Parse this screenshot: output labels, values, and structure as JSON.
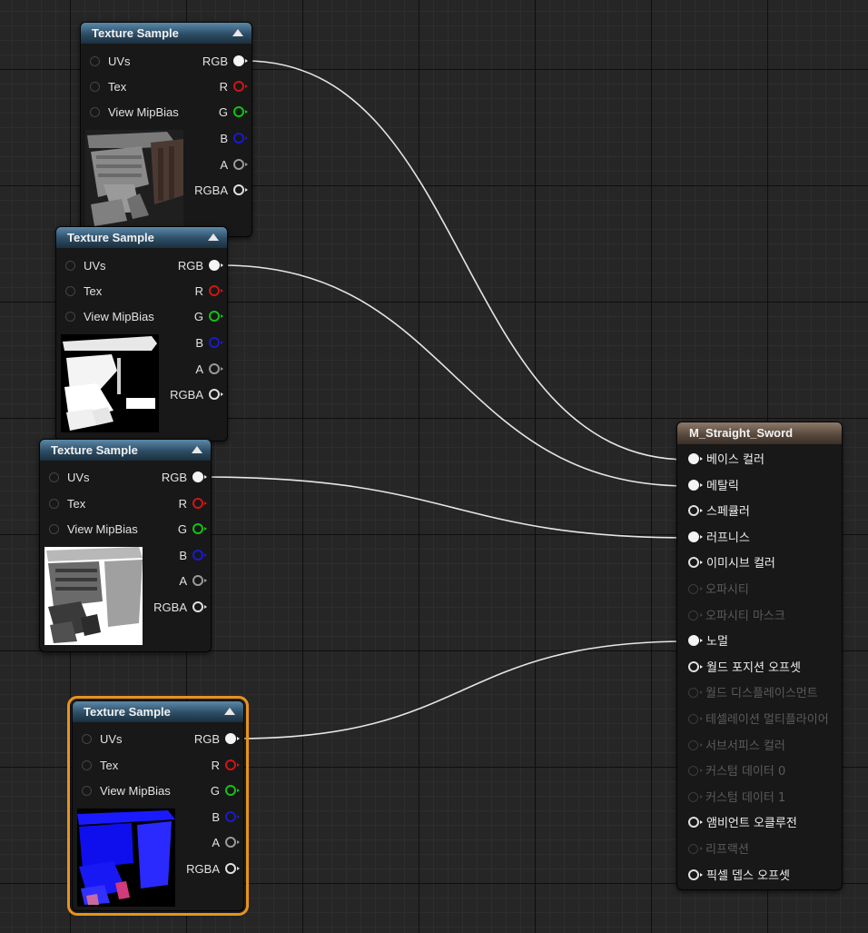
{
  "texture_nodes": [
    {
      "title": "Texture Sample",
      "inputs": [
        "UVs",
        "Tex",
        "View MipBias"
      ],
      "outputs": [
        "RGB",
        "R",
        "G",
        "B",
        "A",
        "RGBA"
      ],
      "preview": "grayscale-basecolor-texture",
      "selected": false
    },
    {
      "title": "Texture Sample",
      "inputs": [
        "UVs",
        "Tex",
        "View MipBias"
      ],
      "outputs": [
        "RGB",
        "R",
        "G",
        "B",
        "A",
        "RGBA"
      ],
      "preview": "white-metallic-mask-texture",
      "selected": false
    },
    {
      "title": "Texture Sample",
      "inputs": [
        "UVs",
        "Tex",
        "View MipBias"
      ],
      "outputs": [
        "RGB",
        "R",
        "G",
        "B",
        "A",
        "RGBA"
      ],
      "preview": "grey-roughness-texture",
      "selected": false
    },
    {
      "title": "Texture Sample",
      "inputs": [
        "UVs",
        "Tex",
        "View MipBias"
      ],
      "outputs": [
        "RGB",
        "R",
        "G",
        "B",
        "A",
        "RGBA"
      ],
      "preview": "blue-normal-map-texture",
      "selected": true
    }
  ],
  "material_node": {
    "title": "M_Straight_Sword",
    "pins": [
      {
        "label": "베이스 컬러",
        "active": true,
        "connected": true
      },
      {
        "label": "메탈릭",
        "active": true,
        "connected": true
      },
      {
        "label": "스페큘러",
        "active": true,
        "connected": false
      },
      {
        "label": "러프니스",
        "active": true,
        "connected": true
      },
      {
        "label": "이미시브 컬러",
        "active": true,
        "connected": false
      },
      {
        "label": "오파시티",
        "active": false,
        "connected": false
      },
      {
        "label": "오파시티 마스크",
        "active": false,
        "connected": false
      },
      {
        "label": "노멀",
        "active": true,
        "connected": true
      },
      {
        "label": "월드 포지션 오프셋",
        "active": true,
        "connected": false
      },
      {
        "label": "월드 디스플레이스먼트",
        "active": false,
        "connected": false
      },
      {
        "label": "테셀레이션 멀티플라이어",
        "active": false,
        "connected": false
      },
      {
        "label": "서브서피스 컬러",
        "active": false,
        "connected": false
      },
      {
        "label": "커스텀 데이터 0",
        "active": false,
        "connected": false
      },
      {
        "label": "커스텀 데이터 1",
        "active": false,
        "connected": false
      },
      {
        "label": "앰비언트 오클루전",
        "active": true,
        "connected": false
      },
      {
        "label": "리프랙션",
        "active": false,
        "connected": false
      },
      {
        "label": "픽셀 뎁스 오프셋",
        "active": true,
        "connected": false
      }
    ]
  },
  "colors": {
    "texture_header": "#2c4d66",
    "material_header": "#5a4a3e",
    "selection_outline": "#e8931c",
    "wire": "#e6e6e6",
    "pin_r": "#d11414",
    "pin_g": "#12c312",
    "pin_b": "#1a1ad0"
  }
}
